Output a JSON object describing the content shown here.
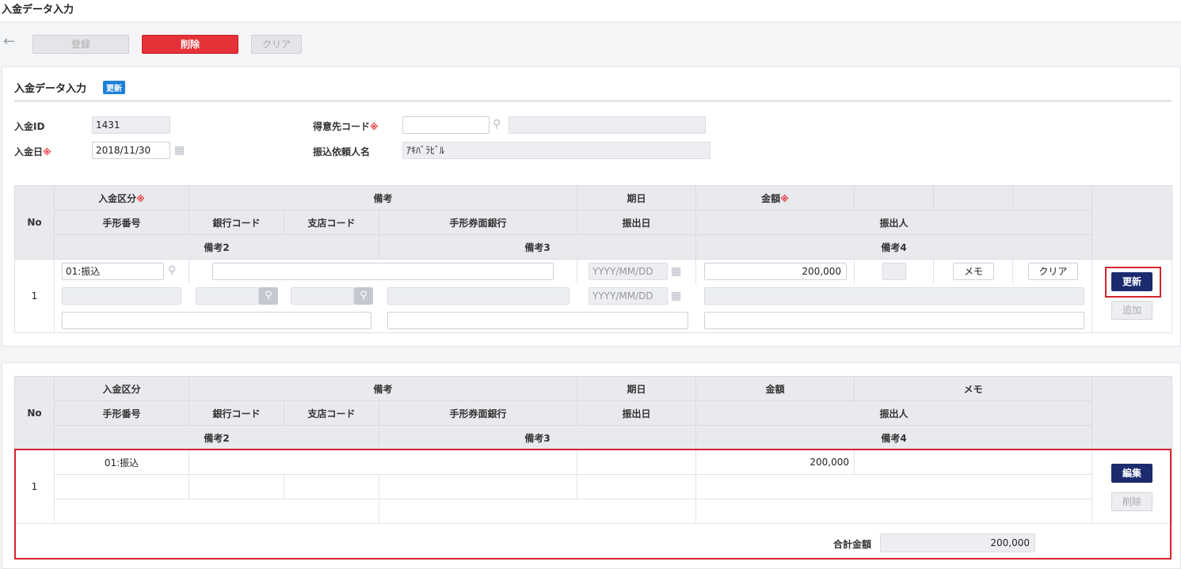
{
  "window": {
    "title": "入金データ入力"
  },
  "toolbar": {
    "back_icon": "arrow-left-icon",
    "register": "登録",
    "delete": "削除",
    "clear": "クリア"
  },
  "form": {
    "section_title": "入金データ入力",
    "badge": "更新",
    "req_mark": "※",
    "payment_id_label": "入金ID",
    "payment_id": "1431",
    "payment_date_label": "入金日",
    "payment_date": "2018/11/30",
    "customer_code_label": "得意先コード",
    "customer_code": "",
    "customer_name": "",
    "transfer_requester_label": "振込依頼人名",
    "transfer_requester": "ｱｷﾊﾞﾗﾋﾞﾙ"
  },
  "headers": {
    "no": "No",
    "payment_type": "入金区分",
    "remarks": "備考",
    "due_date": "期日",
    "amount": "金額",
    "memo": "メモ",
    "note_number": "手形番号",
    "bank_code": "銀行コード",
    "branch_code": "支店コード",
    "note_bank": "手形券面銀行",
    "issue_date": "振出日",
    "drawer": "振出人",
    "remarks2": "備考2",
    "remarks3": "備考3",
    "remarks4": "備考4"
  },
  "entry": {
    "no": "1",
    "payment_type": "01:振込",
    "date_placeholder": "YYYY/MM/DD",
    "amount": "200,000",
    "memo_button": "メモ",
    "clear_button": "クリア",
    "update_button": "更新",
    "add_button": "追加"
  },
  "list": {
    "rows": [
      {
        "no": "1",
        "payment_type": "01:振込",
        "amount": "200,000"
      }
    ],
    "edit_button": "編集",
    "delete_button": "削除",
    "total_label": "合計金額",
    "total_value": "200,000"
  },
  "colors": {
    "accent_navy": "#1b2b6e",
    "danger_red": "#e53238",
    "badge_blue": "#1e7fd9"
  }
}
